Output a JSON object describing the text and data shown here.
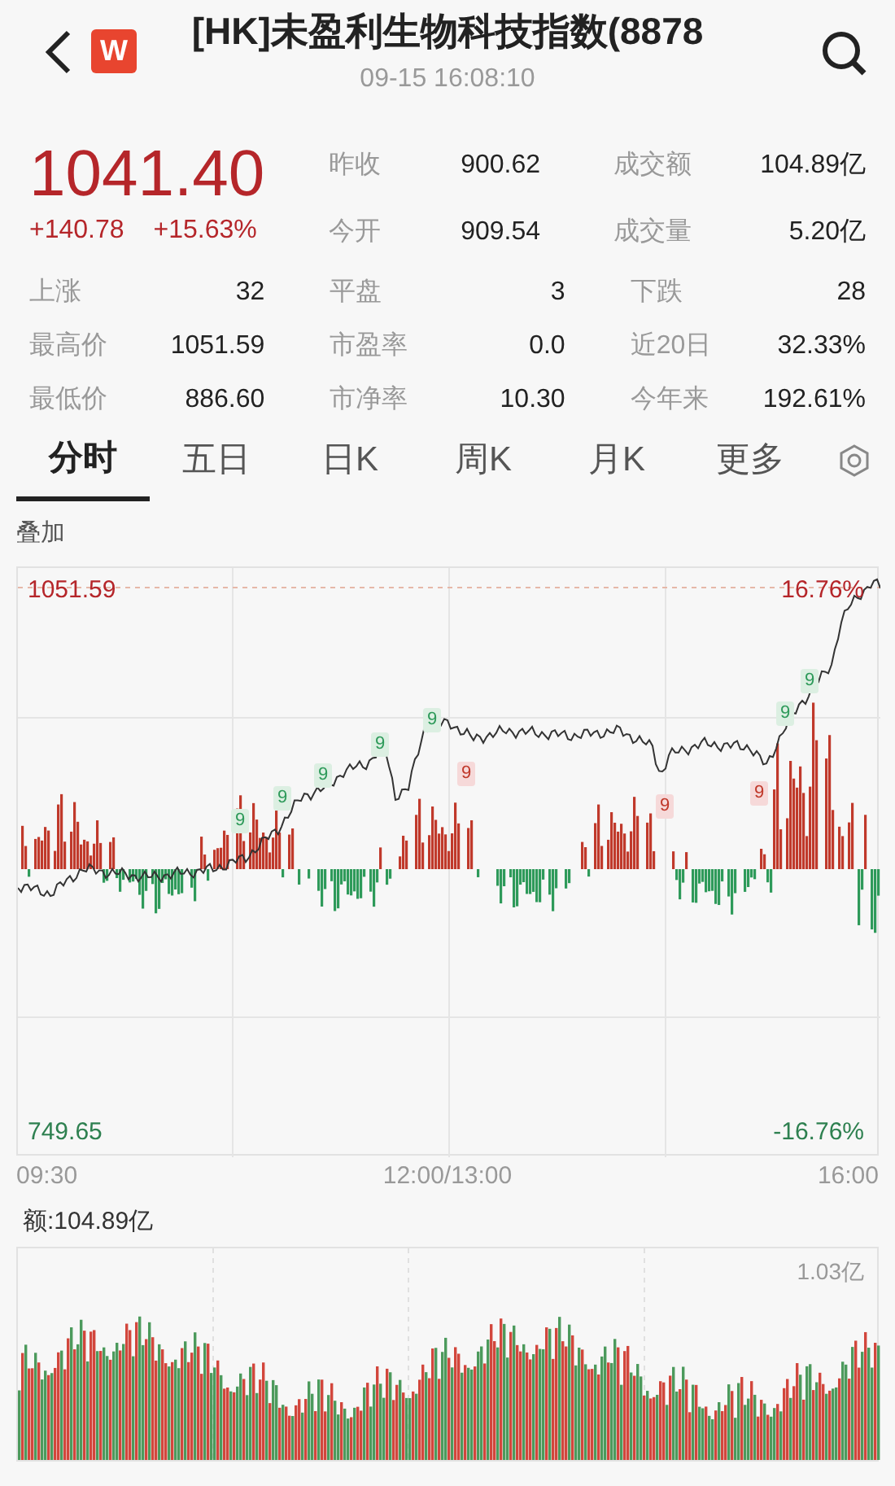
{
  "header": {
    "title": "[HK]未盈利生物科技指数(8878",
    "time": "09-15 16:08:10",
    "badge": "W"
  },
  "quote": {
    "price": "1041.40",
    "change": "+140.78",
    "change_pct": "+15.63%"
  },
  "top_stats": [
    {
      "label": "昨收",
      "value": "900.62"
    },
    {
      "label": "成交额",
      "value": "104.89亿"
    },
    {
      "label": "今开",
      "value": "909.54"
    },
    {
      "label": "成交量",
      "value": "5.20亿"
    }
  ],
  "stats": [
    {
      "label": "上涨",
      "value": "32"
    },
    {
      "label": "平盘",
      "value": "3"
    },
    {
      "label": "下跌",
      "value": "28"
    },
    {
      "label": "最高价",
      "value": "1051.59"
    },
    {
      "label": "市盈率",
      "value": "0.0"
    },
    {
      "label": "近20日",
      "value": "32.33%"
    },
    {
      "label": "最低价",
      "value": "886.60"
    },
    {
      "label": "市净率",
      "value": "10.30"
    },
    {
      "label": "今年来",
      "value": "192.61%"
    }
  ],
  "tabs": [
    {
      "label": "分时",
      "selected": true
    },
    {
      "label": "五日",
      "selected": false
    },
    {
      "label": "日K",
      "selected": false
    },
    {
      "label": "周K",
      "selected": false
    },
    {
      "label": "月K",
      "selected": false
    },
    {
      "label": "更多",
      "selected": false
    }
  ],
  "overlay_label": "叠加",
  "chart": {
    "high": "1051.59",
    "low": "749.65",
    "high_pct": "16.76%",
    "low_pct": "-16.76%",
    "markers": [
      {
        "label": "9",
        "color": "#2e9a5a"
      },
      {
        "label": "9",
        "color": "#2e9a5a"
      },
      {
        "label": "9",
        "color": "#2e9a5a"
      },
      {
        "label": "9",
        "color": "#2e9a5a"
      },
      {
        "label": "9",
        "color": "#2e9a5a"
      },
      {
        "label": "9",
        "color": "#2e9a5a"
      },
      {
        "label": "9",
        "color": "#2e9a5a"
      },
      {
        "label": "9",
        "color": "#c0392b"
      },
      {
        "label": "9",
        "color": "#c0392b"
      },
      {
        "label": "9",
        "color": "#c0392b"
      }
    ],
    "times": [
      "09:30",
      "12:00/13:00",
      "16:00"
    ]
  },
  "volume": {
    "label": "额:104.89亿",
    "max": "1.03亿"
  }
}
